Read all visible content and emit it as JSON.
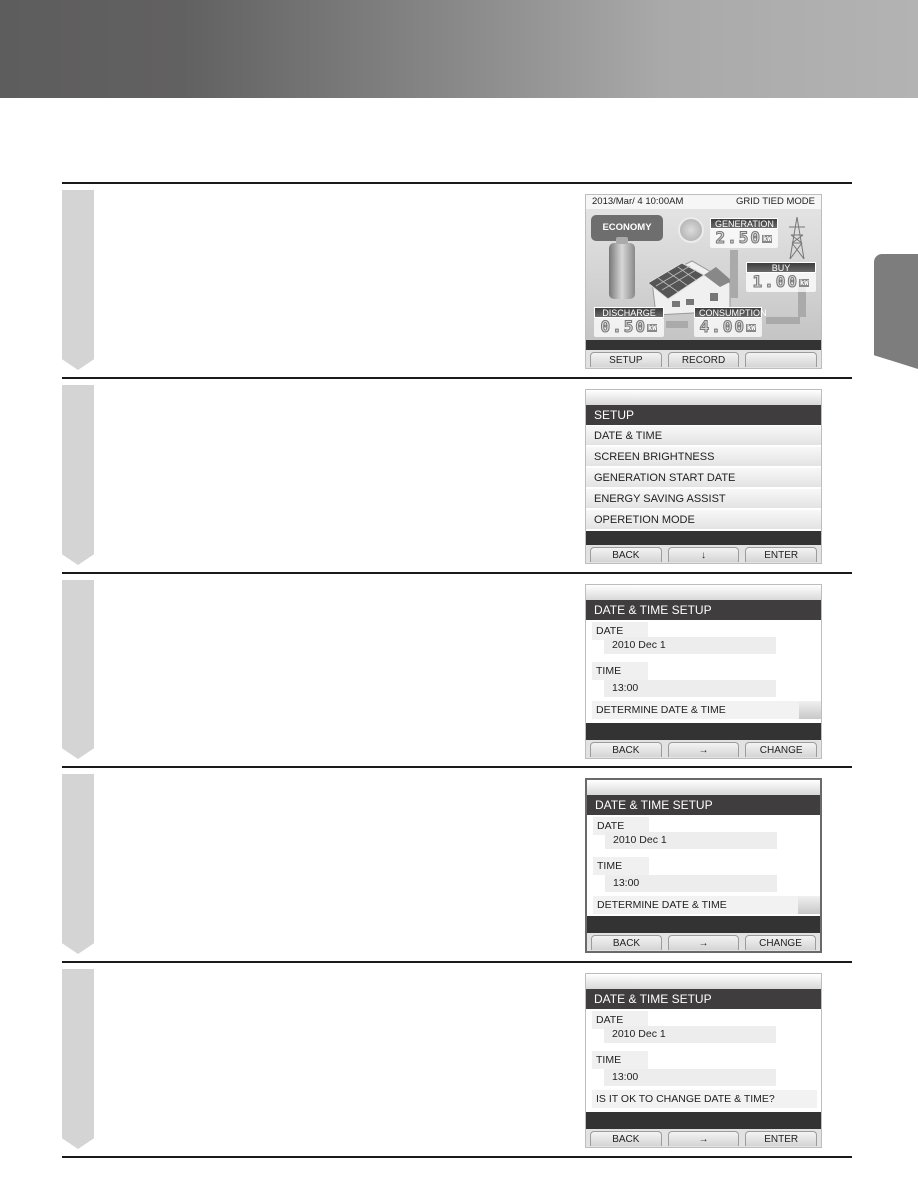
{
  "page": {
    "header_band": "",
    "side_tab": ""
  },
  "steps": [
    {
      "screen": "home",
      "status_bar": {
        "datetime": "2013/Mar/ 4 10:00AM",
        "mode": "GRID TIED MODE"
      },
      "economy_label": "ECONOMY",
      "meters": {
        "generation": {
          "label": "GENERATION",
          "value": "2.50",
          "unit": "kW"
        },
        "buy": {
          "label": "BUY",
          "value": "1.00",
          "unit": "kW"
        },
        "discharge": {
          "label": "DISCHARGE",
          "value": "0.50",
          "unit": "kW"
        },
        "consumption": {
          "label": "CONSUMPTION",
          "value": "4.00",
          "unit": "kW"
        }
      },
      "softkeys": [
        "SETUP",
        "RECORD",
        ""
      ]
    },
    {
      "screen": "setup-menu",
      "title": "SETUP",
      "items": [
        "DATE & TIME",
        "SCREEN BRIGHTNESS",
        "GENERATION START DATE",
        "ENERGY SAVING ASSIST",
        "OPERETION MODE"
      ],
      "softkeys": [
        "BACK",
        "↓",
        "ENTER"
      ]
    },
    {
      "screen": "date-time-setup",
      "title": "DATE & TIME SETUP",
      "date_label": "DATE",
      "date_value": "2010 Dec  1",
      "time_label": "TIME",
      "time_value": "13:00",
      "action": "DETERMINE DATE & TIME",
      "softkeys": [
        "BACK",
        "→",
        "CHANGE"
      ]
    },
    {
      "screen": "date-time-setup",
      "title": "DATE & TIME SETUP",
      "date_label": "DATE",
      "date_value": "2010 Dec  1",
      "time_label": "TIME",
      "time_value": "13:00",
      "action": "DETERMINE DATE & TIME",
      "softkeys": [
        "BACK",
        "→",
        "CHANGE"
      ]
    },
    {
      "screen": "date-time-confirm",
      "title": "DATE & TIME SETUP",
      "date_label": "DATE",
      "date_value": "2010 Dec  1",
      "time_label": "TIME",
      "time_value": "13:00",
      "action": "IS IT OK TO CHANGE DATE & TIME?",
      "softkeys": [
        "BACK",
        "→",
        "ENTER"
      ]
    }
  ]
}
